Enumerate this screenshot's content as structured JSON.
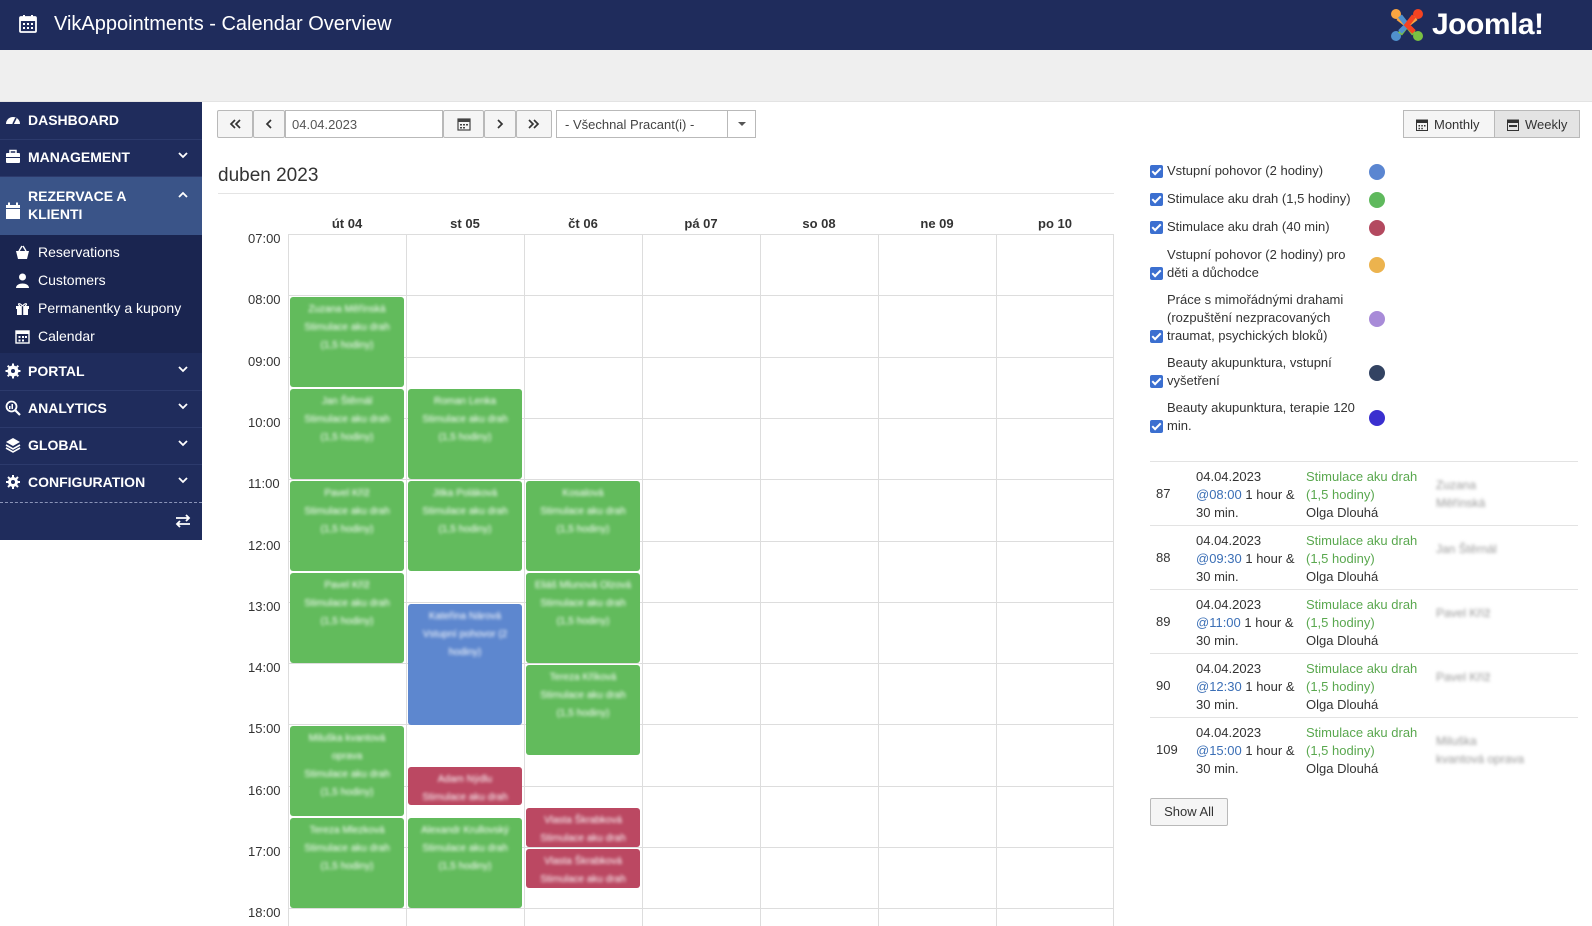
{
  "header": {
    "title": "VikAppointments - Calendar Overview",
    "logo_text": "Joomla!"
  },
  "sidebar": {
    "items": [
      {
        "label": "DASHBOARD",
        "icon": "dashboard-icon"
      },
      {
        "label": "MANAGEMENT",
        "icon": "briefcase-icon"
      },
      {
        "label": "REZERVACE A KLIENTI",
        "icon": "calendar-icon",
        "active": true
      },
      {
        "label": "PORTAL",
        "icon": "gear-icon"
      },
      {
        "label": "ANALYTICS",
        "icon": "search-chart-icon"
      },
      {
        "label": "GLOBAL",
        "icon": "layers-icon"
      },
      {
        "label": "CONFIGURATION",
        "icon": "gears-icon"
      }
    ],
    "subitems": [
      {
        "label": "Reservations",
        "icon": "basket-icon"
      },
      {
        "label": "Customers",
        "icon": "user-icon"
      },
      {
        "label": "Permanentky a kupony",
        "icon": "gift-icon"
      },
      {
        "label": "Calendar",
        "icon": "calendar-icon"
      }
    ]
  },
  "toolbar": {
    "date_value": "04.04.2023",
    "employee_select": "- Všechnal Pracant(i) -",
    "monthly_label": "Monthly",
    "weekly_label": "Weekly"
  },
  "calendar": {
    "month_title": "duben 2023",
    "days": [
      "út 04",
      "st 05",
      "čt 06",
      "pá 07",
      "so 08",
      "ne 09",
      "po 10"
    ],
    "hours": [
      "07:00",
      "08:00",
      "09:00",
      "10:00",
      "11:00",
      "12:00",
      "13:00",
      "14:00",
      "15:00",
      "16:00",
      "17:00",
      "18:00"
    ],
    "events": [
      {
        "day": 0,
        "start": 8.0,
        "end": 9.5,
        "color": "green",
        "lines": [
          "Zuzana Měřínská",
          "Stimulace aku drah",
          "(1,5 hodiny)"
        ]
      },
      {
        "day": 0,
        "start": 9.5,
        "end": 11.0,
        "color": "green",
        "lines": [
          "Jan Štěrnál",
          "Stimulace aku drah",
          "(1,5 hodiny)"
        ]
      },
      {
        "day": 0,
        "start": 11.0,
        "end": 12.5,
        "color": "green",
        "lines": [
          "Pavel Kříž",
          "Stimulace aku drah",
          "(1,5 hodiny)"
        ]
      },
      {
        "day": 0,
        "start": 12.5,
        "end": 14.0,
        "color": "green",
        "lines": [
          "Pavel Kříž",
          "Stimulace aku drah",
          "(1,5 hodiny)"
        ]
      },
      {
        "day": 0,
        "start": 15.0,
        "end": 16.5,
        "color": "green",
        "lines": [
          "Miluška kvantová",
          "oprava",
          "Stimulace aku drah",
          "(1,5 hodiny)"
        ]
      },
      {
        "day": 0,
        "start": 16.5,
        "end": 18.0,
        "color": "green",
        "lines": [
          "Tereza Mlezková",
          "Stimulace aku drah",
          "(1,5 hodiny)"
        ]
      },
      {
        "day": 1,
        "start": 9.5,
        "end": 11.0,
        "color": "green",
        "lines": [
          "Roman Lenka",
          "Stimulace aku drah",
          "(1,5 hodiny)"
        ]
      },
      {
        "day": 1,
        "start": 11.0,
        "end": 12.5,
        "color": "green",
        "lines": [
          "Jitka Poláková",
          "Stimulace aku drah",
          "(1,5 hodiny)"
        ]
      },
      {
        "day": 1,
        "start": 13.0,
        "end": 15.0,
        "color": "blue",
        "lines": [
          "Kateřina Nárová",
          "Vstupní pohovor (2",
          "hodiny)"
        ]
      },
      {
        "day": 1,
        "start": 15.67,
        "end": 16.33,
        "color": "red",
        "lines": [
          "Adam Nýdlu",
          "Stimulace aku drah"
        ]
      },
      {
        "day": 1,
        "start": 16.5,
        "end": 18.0,
        "color": "green",
        "lines": [
          "Alexandr Krullovský",
          "Stimulace aku drah",
          "(1,5 hodiny)"
        ]
      },
      {
        "day": 2,
        "start": 11.0,
        "end": 12.5,
        "color": "green",
        "lines": [
          "Kosalová",
          "Stimulace aku drah",
          "(1,5 hodiny)"
        ]
      },
      {
        "day": 2,
        "start": 12.5,
        "end": 14.0,
        "color": "green",
        "lines": [
          "Eliáš Mlunová Olzová",
          "Stimulace aku drah",
          "(1,5 hodiny)"
        ]
      },
      {
        "day": 2,
        "start": 14.0,
        "end": 15.5,
        "color": "green",
        "lines": [
          "Tereza Kříková",
          "Stimulace aku drah",
          "(1,5 hodiny)"
        ]
      },
      {
        "day": 2,
        "start": 16.33,
        "end": 17.0,
        "color": "red",
        "lines": [
          "Vlasta Škrabková",
          "Stimulace aku drah"
        ]
      },
      {
        "day": 2,
        "start": 17.0,
        "end": 17.67,
        "color": "red",
        "lines": [
          "Vlasta Škrabková",
          "Stimulace aku drah"
        ]
      }
    ]
  },
  "legend": [
    {
      "label": "Vstupní pohovor (2 hodiny)",
      "color": "#5b86d1"
    },
    {
      "label": "Stimulace aku drah (1,5 hodiny)",
      "color": "#5fb95d"
    },
    {
      "label": "Stimulace aku drah (40 min)",
      "color": "#b3495f"
    },
    {
      "label": "Vstupní pohovor (2 hodiny) pro děti a důchodce",
      "color": "#ecb34e"
    },
    {
      "label": "Práce s mimořádnými drahami (rozpuštění nezpracovaných traumat, psychických bloků)",
      "color": "#a88bd8"
    },
    {
      "label": "Beauty akupunktura, vstupní vyšetření",
      "color": "#334362"
    },
    {
      "label": "Beauty akupunktura, terapie 120 min.",
      "color": "#3a2fcf"
    }
  ],
  "appointments": [
    {
      "id": "87",
      "date": "04.04.2023",
      "time": "@08:00",
      "duration": "1 hour & 30 min.",
      "service": "Stimulace aku drah (1,5 hodiny)",
      "employee": "Olga Dlouhá",
      "customer": "Zuzana Měřínská"
    },
    {
      "id": "88",
      "date": "04.04.2023",
      "time": "@09:30",
      "duration": "1 hour & 30 min.",
      "service": "Stimulace aku drah (1,5 hodiny)",
      "employee": "Olga Dlouhá",
      "customer": "Jan Štěrnál"
    },
    {
      "id": "89",
      "date": "04.04.2023",
      "time": "@11:00",
      "duration": "1 hour & 30 min.",
      "service": "Stimulace aku drah (1,5 hodiny)",
      "employee": "Olga Dlouhá",
      "customer": "Pavel Kříž"
    },
    {
      "id": "90",
      "date": "04.04.2023",
      "time": "@12:30",
      "duration": "1 hour & 30 min.",
      "service": "Stimulace aku drah (1,5 hodiny)",
      "employee": "Olga Dlouhá",
      "customer": "Pavel Kříž"
    },
    {
      "id": "109",
      "date": "04.04.2023",
      "time": "@15:00",
      "duration": "1 hour & 30 min.",
      "service": "Stimulace aku drah (1,5 hodiny)",
      "employee": "Olga Dlouhá",
      "customer": "Miluška kvantová oprava"
    }
  ],
  "show_all_label": "Show All"
}
